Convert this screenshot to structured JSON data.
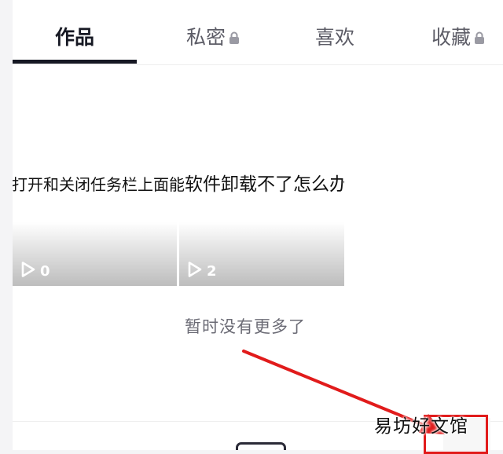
{
  "tabs": [
    {
      "label": "作品",
      "active": true
    },
    {
      "label": "私密",
      "locked": true
    },
    {
      "label": "喜欢"
    },
    {
      "label": "收藏",
      "locked": true
    }
  ],
  "content": {
    "title_left": "么打开和关闭任务栏上面能",
    "title_right": "软件卸载不了怎么办"
  },
  "videos": [
    {
      "play_count": "0"
    },
    {
      "play_count": "2"
    }
  ],
  "footer_text": "暂时没有更多了",
  "annotation": {
    "color": "#e11b1b"
  },
  "watermark": "易坊好文馆",
  "icons": [
    "lock-icon",
    "play-icon"
  ]
}
